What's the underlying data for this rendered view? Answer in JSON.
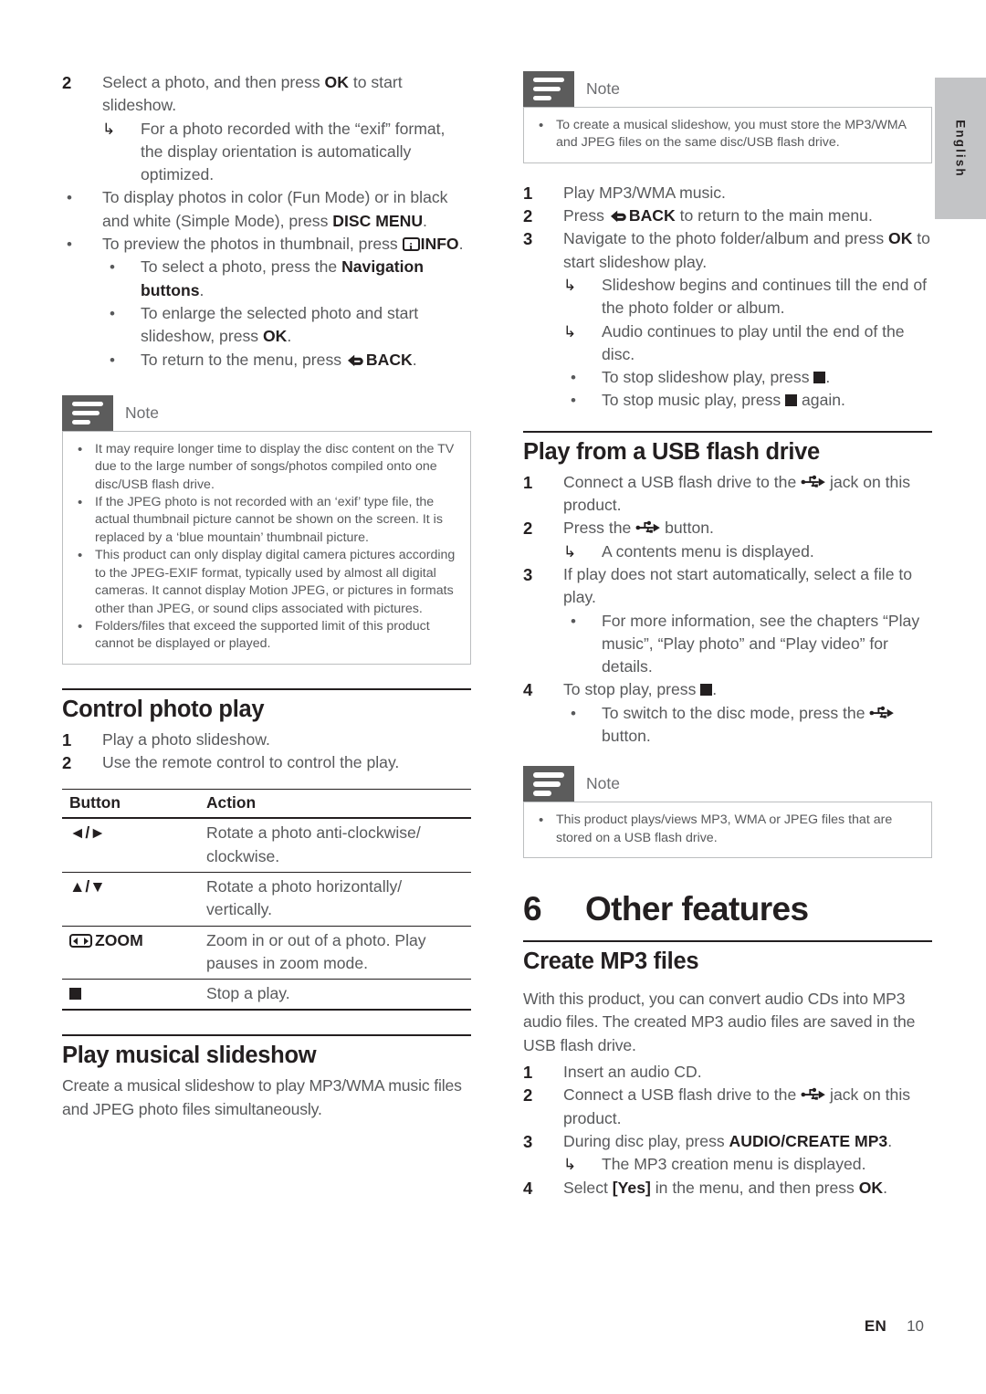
{
  "page": {
    "language_tab": "English",
    "footer_lang": "EN",
    "footer_page": "10"
  },
  "icons": {
    "note": "note-icon",
    "info": "info-icon",
    "stop": "stop-square-icon",
    "zoom": "zoom-icon",
    "back": "back-arrow-icon",
    "usb": "usb-icon"
  },
  "colors": {
    "body_text": "#58595b",
    "heading": "#231f20",
    "note_tab": "#5c5c5c",
    "note_border": "#bcbec0",
    "lang_tab": "#c3c4c6"
  },
  "left_column": {
    "step2": {
      "num": "2",
      "text_a": "Select a photo, and then press ",
      "bold_ok": "OK",
      "text_b": " to start slideshow."
    },
    "step2_arrow": "For a photo recorded with the “exif” format, the display orientation is automatically optimized.",
    "bullet_disc_menu": {
      "text_a": "To display photos in color (Fun Mode) or in black and white (Simple Mode), press ",
      "bold": "DISC MENU",
      "text_b": "."
    },
    "bullet_info": {
      "text_a": "To preview the photos in thumbnail, press ",
      "bold": "INFO",
      "text_b": "."
    },
    "sub_bullets": [
      {
        "text_a": "To select a photo, press the ",
        "bold": "Navigation buttons",
        "text_b": "."
      },
      {
        "text_a": "To enlarge the selected photo and start slideshow, press ",
        "bold": "OK",
        "text_b": "."
      },
      {
        "text_a": "To return to the menu, press ",
        "bold": "BACK",
        "text_b": "."
      }
    ],
    "note": {
      "title": "Note",
      "items": [
        "It may require longer time to display the disc content on the TV due to the large number of songs/photos compiled onto one disc/USB flash drive.",
        "If the JPEG photo is not recorded with an ‘exif’ type file, the actual thumbnail picture cannot be shown on the screen. It is replaced by a ‘blue mountain’ thumbnail picture.",
        "This product can only display digital camera pictures according to the JPEG-EXIF format, typically used by almost all digital cameras. It cannot display Motion JPEG, or pictures in formats other than JPEG, or sound clips associated with pictures.",
        "Folders/files that exceed the supported limit of this product cannot be displayed or played."
      ]
    },
    "control_photo_play": {
      "heading": "Control photo play",
      "steps": [
        {
          "num": "1",
          "text": "Play a photo slideshow."
        },
        {
          "num": "2",
          "text": "Use the remote control to control the play."
        }
      ]
    },
    "button_table": {
      "headers": [
        "Button",
        "Action"
      ],
      "rows": [
        {
          "button": "◄/►",
          "action": "Rotate a photo anti-clockwise/ clockwise."
        },
        {
          "button": "▲/▼",
          "action": "Rotate a photo horizontally/ vertically."
        },
        {
          "button": "ZOOM",
          "action": "Zoom in or out of a photo. Play pauses in zoom mode."
        },
        {
          "button": "",
          "action": "Stop a play."
        }
      ]
    },
    "play_musical_slideshow": {
      "heading": "Play musical slideshow",
      "paragraph": "Create a musical slideshow to play MP3/WMA music files and JPEG photo files simultaneously."
    }
  },
  "right_column": {
    "note_top": {
      "title": "Note",
      "items": [
        "To create a musical slideshow, you must store the MP3/WMA and JPEG files on the same disc/USB flash drive."
      ]
    },
    "steps": [
      {
        "num": "1",
        "text": "Play MP3/WMA music."
      },
      {
        "num": "2",
        "text_a": "Press ",
        "bold": "BACK",
        "text_b": " to return to the main menu."
      },
      {
        "num": "3",
        "text_a": "Navigate to the photo folder/album and press ",
        "bold": "OK",
        "text_b": " to start slideshow play."
      }
    ],
    "step3_arrows": [
      "Slideshow begins and continues till the end of the photo folder or album.",
      "Audio continues to play until the end of the disc."
    ],
    "step3_bullets": [
      {
        "text_a": "To stop slideshow play, press ",
        "text_b": "."
      },
      {
        "text_a": "To stop music play, press ",
        "text_b": " again."
      }
    ],
    "usb_section": {
      "heading": "Play from a USB flash drive",
      "step1": {
        "num": "1",
        "text_a": "Connect a USB flash drive to the ",
        "text_b": " jack on this product."
      },
      "step2": {
        "num": "2",
        "text_a": "Press the ",
        "text_b": " button."
      },
      "step2_arrow": "A contents menu is displayed.",
      "step3": {
        "num": "3",
        "text": "If play does not start automatically, select a file to play."
      },
      "step3_bullet": "For more information, see the chapters “Play music”, “Play photo” and “Play video” for details.",
      "step4": {
        "num": "4",
        "text_a": "To stop play, press ",
        "text_b": "."
      },
      "step4_bullet": {
        "text_a": "To switch to the disc mode, press the ",
        "text_b": " button."
      },
      "note": {
        "title": "Note",
        "items": [
          "This product plays/views MP3, WMA or JPEG files that are stored on a USB flash drive."
        ]
      }
    },
    "chapter": {
      "num": "6",
      "title": "Other features"
    },
    "create_mp3": {
      "heading": "Create MP3 files",
      "paragraph": "With this product, you can convert audio CDs into MP3 audio files. The created MP3 audio files are saved in the USB flash drive.",
      "steps": [
        {
          "num": "1",
          "text": "Insert an audio CD."
        },
        {
          "num": "2",
          "text_a": "Connect a USB flash drive to the ",
          "text_b": " jack on this product."
        },
        {
          "num": "3",
          "text_a": "During disc play, press ",
          "bold": "AUDIO/CREATE MP3",
          "text_b": "."
        }
      ],
      "step3_arrow": "The MP3 creation menu is displayed.",
      "step4": {
        "num": "4",
        "text_a": "Select ",
        "bold": "[Yes]",
        "text_b": " in the menu, and then press ",
        "bold2": "OK",
        "text_c": "."
      }
    }
  }
}
